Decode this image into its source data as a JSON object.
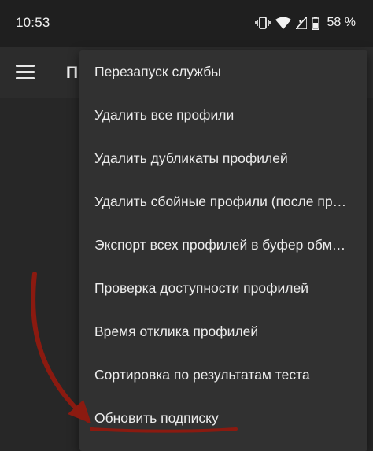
{
  "status_bar": {
    "time": "10:53",
    "battery": "58 %",
    "icons": [
      "vibrate-icon",
      "wifi-icon",
      "signal-icon",
      "battery-icon"
    ]
  },
  "app_bar": {
    "title": "П",
    "menu_icon": "hamburger-menu-icon"
  },
  "menu": {
    "items": [
      {
        "label": "Перезапуск службы"
      },
      {
        "label": "Удалить все профили"
      },
      {
        "label": "Удалить дубликаты профилей"
      },
      {
        "label": "Удалить сбойные профили (после проверки)"
      },
      {
        "label": "Экспорт всех профилей в буфер обмена"
      },
      {
        "label": "Проверка доступности профилей"
      },
      {
        "label": "Время отклика профилей"
      },
      {
        "label": "Сортировка по результатам теста"
      },
      {
        "label": "Обновить подписку"
      }
    ]
  },
  "colors": {
    "background": "#272727",
    "app_bar": "#2c2c2c",
    "menu": "#313131",
    "annotation": "#8b1a10"
  }
}
